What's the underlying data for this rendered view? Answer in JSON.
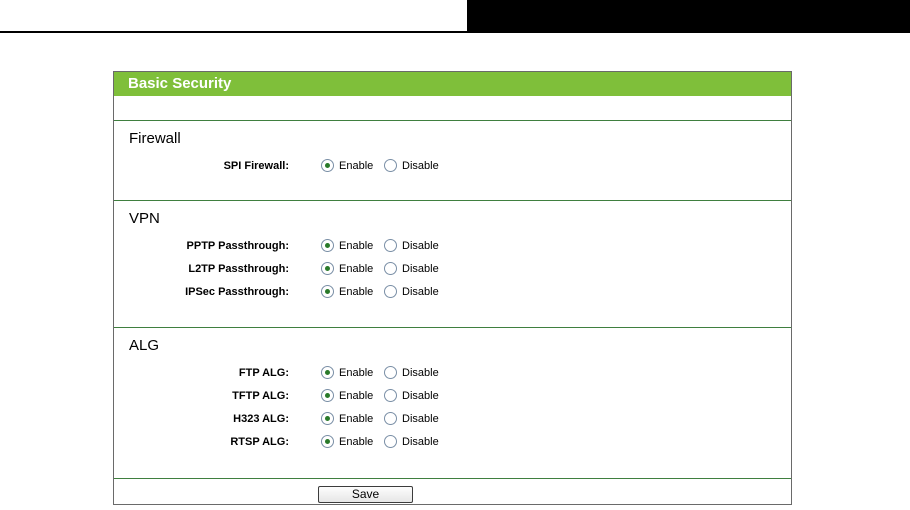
{
  "panel": {
    "title": "Basic Security"
  },
  "sections": {
    "firewall": {
      "title": "Firewall",
      "rows": [
        {
          "label": "SPI Firewall:",
          "enable": "Enable",
          "disable": "Disable",
          "selected": "enable"
        }
      ]
    },
    "vpn": {
      "title": "VPN",
      "rows": [
        {
          "label": "PPTP Passthrough:",
          "enable": "Enable",
          "disable": "Disable",
          "selected": "enable"
        },
        {
          "label": "L2TP Passthrough:",
          "enable": "Enable",
          "disable": "Disable",
          "selected": "enable"
        },
        {
          "label": "IPSec Passthrough:",
          "enable": "Enable",
          "disable": "Disable",
          "selected": "enable"
        }
      ]
    },
    "alg": {
      "title": "ALG",
      "rows": [
        {
          "label": "FTP ALG:",
          "enable": "Enable",
          "disable": "Disable",
          "selected": "enable"
        },
        {
          "label": "TFTP ALG:",
          "enable": "Enable",
          "disable": "Disable",
          "selected": "enable"
        },
        {
          "label": "H323 ALG:",
          "enable": "Enable",
          "disable": "Disable",
          "selected": "enable"
        },
        {
          "label": "RTSP ALG:",
          "enable": "Enable",
          "disable": "Disable",
          "selected": "enable"
        }
      ]
    }
  },
  "footer": {
    "save_label": "Save"
  },
  "colors": {
    "header_green": "#7fbf3a",
    "divider_green": "#3f7f3f",
    "radio_dot": "#2a7a2a"
  }
}
